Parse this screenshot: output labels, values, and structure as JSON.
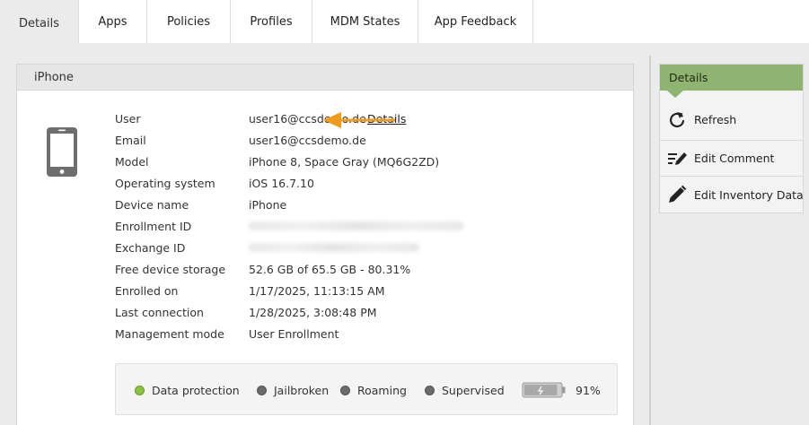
{
  "tabs": [
    {
      "label": "Details",
      "active": true
    },
    {
      "label": "Apps"
    },
    {
      "label": "Policies"
    },
    {
      "label": "Profiles"
    },
    {
      "label": "MDM States"
    },
    {
      "label": "App Feedback"
    }
  ],
  "panel": {
    "title": "iPhone",
    "details_link": "Details",
    "rows": [
      {
        "label": "User",
        "value": "user16@ccsdemo.de"
      },
      {
        "label": "Email",
        "value": "user16@ccsdemo.de"
      },
      {
        "label": "Model",
        "value": "iPhone 8, Space Gray (MQ6G2ZD)"
      },
      {
        "label": "Operating system",
        "value": "iOS 16.7.10"
      },
      {
        "label": "Device name",
        "value": "iPhone"
      },
      {
        "label": "Enrollment ID",
        "value": ""
      },
      {
        "label": "Exchange ID",
        "value": ""
      },
      {
        "label": "Free device storage",
        "value": "52.6 GB of 65.5 GB - 80.31%"
      },
      {
        "label": "Enrolled on",
        "value": "1/17/2025, 11:13:15 AM"
      },
      {
        "label": "Last connection",
        "value": "1/28/2025, 3:08:48 PM"
      },
      {
        "label": "Management mode",
        "value": "User Enrollment"
      }
    ],
    "status": {
      "data_protection": {
        "label": "Data protection",
        "color": "#8ac13f"
      },
      "jailbroken": {
        "label": "Jailbroken",
        "color": "#6b6b6b"
      },
      "roaming": {
        "label": "Roaming",
        "color": "#6b6b6b"
      },
      "supervised": {
        "label": "Supervised",
        "color": "#6b6b6b"
      },
      "battery": {
        "level": 0.91,
        "label": "91%"
      }
    }
  },
  "sidebar": {
    "title": "Details",
    "header_color": "#8fb371",
    "actions": [
      {
        "label": "Refresh",
        "icon": "refresh-icon"
      },
      {
        "label": "Edit Comment",
        "icon": "edit-comment-icon"
      },
      {
        "label": "Edit Inventory Data",
        "icon": "pencil-icon"
      }
    ]
  },
  "colors": {
    "accent_arrow": "#f29a1c"
  }
}
